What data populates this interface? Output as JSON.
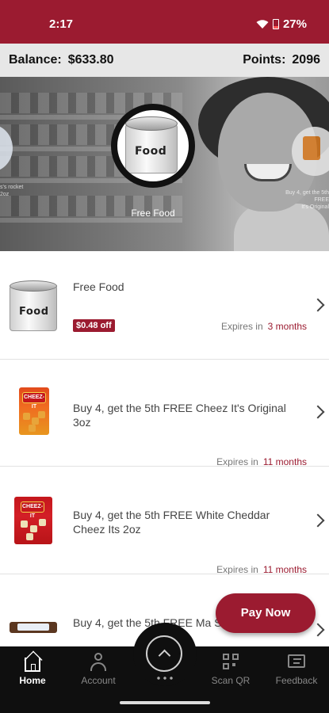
{
  "status_bar": {
    "time": "2:17",
    "battery": "27%"
  },
  "account": {
    "balance_label": "Balance:",
    "balance_value": "$633.80",
    "points_label": "Points:",
    "points_value": "2096"
  },
  "carousel": {
    "selected_label": "Free Food",
    "selected_image_text": "Food",
    "left_caption": "s's rocket\n2oz",
    "right_caption": "Buy 4, get the 5th FREE\nIt's Original"
  },
  "offers": [
    {
      "title": "Free Food",
      "badge": "$0.48 off",
      "expires_label": "Expires in",
      "expires_value": "3 months",
      "image_text": "Food"
    },
    {
      "title": "Buy 4, get the 5th FREE Cheez It's Original 3oz",
      "expires_label": "Expires in",
      "expires_value": "11 months",
      "image_text": "CHEEZ-IT"
    },
    {
      "title": "Buy 4, get the 5th FREE White Cheddar Cheez Its 2oz",
      "expires_label": "Expires in",
      "expires_value": "11 months",
      "image_text": "CHEEZ-IT"
    },
    {
      "title": "Buy 4, get the 5th FREE Ma Single"
    }
  ],
  "pay_now": "Pay Now",
  "nav": {
    "home": "Home",
    "account": "Account",
    "scan_qr": "Scan QR",
    "feedback": "Feedback"
  },
  "colors": {
    "brand": "#9b1b30",
    "nav_bg": "#0f0f0f",
    "balance_bg": "#e7e7e7"
  }
}
